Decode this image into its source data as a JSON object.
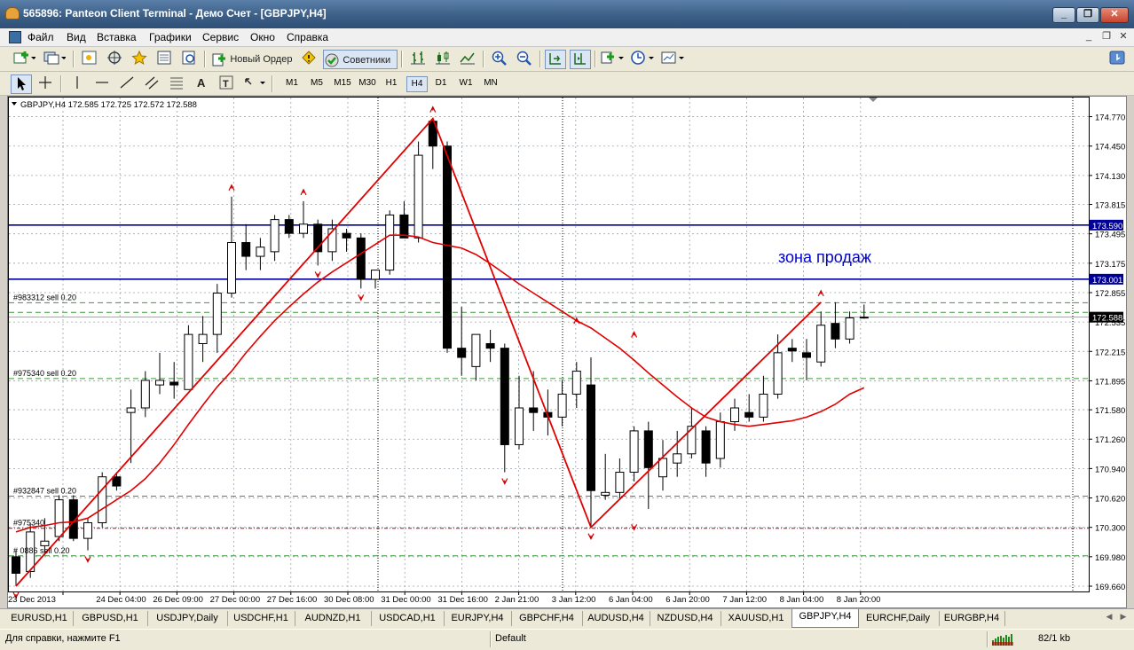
{
  "window": {
    "title": "565896: Panteon Client Terminal - Демо Счет - [GBPJPY,H4]",
    "minimize": "_",
    "restore": "❐",
    "close": "✕"
  },
  "menu": {
    "items": [
      "Файл",
      "Вид",
      "Вставка",
      "Графики",
      "Сервис",
      "Окно",
      "Справка"
    ],
    "child_min": "_",
    "child_restore": "❐",
    "child_close": "✕"
  },
  "toolbar1": {
    "new_order": "Новый Ордер",
    "advisors": "Советники"
  },
  "toolbar2": {
    "timeframes": [
      "M1",
      "M5",
      "M15",
      "M30",
      "H1",
      "H4",
      "D1",
      "W1",
      "MN"
    ],
    "active_timeframe": "H4"
  },
  "chart": {
    "header": "GBPJPY,H4  172.585 172.725 172.572 172.588",
    "annotation": "зона продаж",
    "annotation_color": "#0000cc",
    "bull_color": "#ffffff",
    "bear_color": "#000000",
    "ma_color": "#e00000",
    "level_color": "#000099",
    "price_labels": [
      "174.770",
      "174.450",
      "174.130",
      "173.815",
      "173.495",
      "173.175",
      "172.855",
      "172.535",
      "172.215",
      "171.895",
      "171.580",
      "171.260",
      "170.940",
      "170.620",
      "170.300",
      "169.980",
      "169.660"
    ],
    "highlighted_prices": [
      {
        "value": "173.590",
        "type": "level"
      },
      {
        "value": "173.001",
        "type": "level"
      },
      {
        "value": "172.588",
        "type": "bid"
      }
    ],
    "order_labels": [
      {
        "text": "#983312 sell 0.20",
        "price": 172.745
      },
      {
        "text": "#975340 sell 0.20",
        "price": 171.92
      },
      {
        "text": "#932847 sell 0.20",
        "price": 170.64
      },
      {
        "text": "#975340",
        "price": 170.29
      },
      {
        "text": "# 0886 sell 0.20",
        "price": 169.99
      }
    ],
    "time_labels": [
      "23 Dec 2013",
      "24 Dec 04:00",
      "26 Dec 09:00",
      "27 Dec 00:00",
      "27 Dec 16:00",
      "30 Dec 08:00",
      "31 Dec 00:00",
      "31 Dec 16:00",
      "2 Jan 21:00",
      "3 Jan 12:00",
      "6 Jan 04:00",
      "6 Jan 20:00",
      "7 Jan 12:00",
      "8 Jan 04:00",
      "8 Jan 20:00"
    ]
  },
  "chart_data": {
    "type": "candlestick",
    "symbol": "GBPJPY",
    "timeframe": "H4",
    "ylim": [
      169.66,
      174.93
    ],
    "levels": [
      173.59,
      173.001
    ],
    "bid": 172.588,
    "dashed_levels": [
      172.745,
      172.64,
      171.92,
      170.64,
      170.29,
      169.99
    ],
    "candles": [
      {
        "o": 169.98,
        "h": 170.05,
        "l": 169.66,
        "c": 169.8
      },
      {
        "o": 169.82,
        "h": 170.35,
        "l": 169.75,
        "c": 170.25
      },
      {
        "o": 170.1,
        "h": 170.4,
        "l": 170.0,
        "c": 170.15
      },
      {
        "o": 170.2,
        "h": 170.65,
        "l": 170.15,
        "c": 170.6
      },
      {
        "o": 170.6,
        "h": 170.65,
        "l": 170.15,
        "c": 170.18
      },
      {
        "o": 170.18,
        "h": 170.4,
        "l": 170.05,
        "c": 170.35
      },
      {
        "o": 170.35,
        "h": 170.9,
        "l": 170.3,
        "c": 170.85
      },
      {
        "o": 170.85,
        "h": 170.9,
        "l": 170.7,
        "c": 170.75
      },
      {
        "o": 171.55,
        "h": 171.8,
        "l": 171.0,
        "c": 171.6
      },
      {
        "o": 171.6,
        "h": 172.0,
        "l": 171.5,
        "c": 171.9
      },
      {
        "o": 171.85,
        "h": 172.2,
        "l": 171.75,
        "c": 171.9
      },
      {
        "o": 171.88,
        "h": 172.1,
        "l": 171.7,
        "c": 171.85
      },
      {
        "o": 171.8,
        "h": 172.5,
        "l": 171.8,
        "c": 172.4
      },
      {
        "o": 172.3,
        "h": 172.6,
        "l": 172.1,
        "c": 172.4
      },
      {
        "o": 172.4,
        "h": 172.95,
        "l": 172.2,
        "c": 172.85
      },
      {
        "o": 172.85,
        "h": 173.9,
        "l": 172.8,
        "c": 173.4
      },
      {
        "o": 173.4,
        "h": 173.6,
        "l": 173.1,
        "c": 173.25
      },
      {
        "o": 173.25,
        "h": 173.45,
        "l": 173.1,
        "c": 173.35
      },
      {
        "o": 173.3,
        "h": 173.7,
        "l": 173.2,
        "c": 173.65
      },
      {
        "o": 173.65,
        "h": 173.7,
        "l": 173.45,
        "c": 173.5
      },
      {
        "o": 173.5,
        "h": 173.85,
        "l": 173.45,
        "c": 173.6
      },
      {
        "o": 173.6,
        "h": 173.65,
        "l": 173.15,
        "c": 173.3
      },
      {
        "o": 173.3,
        "h": 173.65,
        "l": 173.2,
        "c": 173.55
      },
      {
        "o": 173.5,
        "h": 173.55,
        "l": 173.3,
        "c": 173.45
      },
      {
        "o": 173.45,
        "h": 173.5,
        "l": 172.9,
        "c": 173.0
      },
      {
        "o": 173.0,
        "h": 173.1,
        "l": 172.9,
        "c": 173.1
      },
      {
        "o": 173.1,
        "h": 173.75,
        "l": 173.05,
        "c": 173.7
      },
      {
        "o": 173.7,
        "h": 173.85,
        "l": 173.5,
        "c": 173.45
      },
      {
        "o": 173.45,
        "h": 174.5,
        "l": 173.4,
        "c": 174.35
      },
      {
        "o": 174.72,
        "h": 174.75,
        "l": 174.2,
        "c": 174.45
      },
      {
        "o": 174.45,
        "h": 174.5,
        "l": 172.2,
        "c": 172.25
      },
      {
        "o": 172.25,
        "h": 172.7,
        "l": 171.95,
        "c": 172.15
      },
      {
        "o": 172.05,
        "h": 172.4,
        "l": 171.9,
        "c": 172.4
      },
      {
        "o": 172.3,
        "h": 172.45,
        "l": 172.1,
        "c": 172.25
      },
      {
        "o": 172.25,
        "h": 172.3,
        "l": 170.9,
        "c": 171.2
      },
      {
        "o": 171.2,
        "h": 171.95,
        "l": 171.15,
        "c": 171.6
      },
      {
        "o": 171.6,
        "h": 172.0,
        "l": 171.35,
        "c": 171.55
      },
      {
        "o": 171.55,
        "h": 171.8,
        "l": 171.3,
        "c": 171.5
      },
      {
        "o": 171.5,
        "h": 171.9,
        "l": 171.4,
        "c": 171.75
      },
      {
        "o": 171.75,
        "h": 172.1,
        "l": 171.6,
        "c": 172.0
      },
      {
        "o": 171.85,
        "h": 172.15,
        "l": 170.3,
        "c": 170.7
      },
      {
        "o": 170.65,
        "h": 171.1,
        "l": 170.6,
        "c": 170.68
      },
      {
        "o": 170.68,
        "h": 171.05,
        "l": 170.6,
        "c": 170.9
      },
      {
        "o": 170.9,
        "h": 171.4,
        "l": 170.8,
        "c": 171.35
      },
      {
        "o": 171.35,
        "h": 171.45,
        "l": 170.5,
        "c": 170.95
      },
      {
        "o": 170.85,
        "h": 171.25,
        "l": 170.7,
        "c": 171.05
      },
      {
        "o": 171.0,
        "h": 171.35,
        "l": 170.85,
        "c": 171.1
      },
      {
        "o": 171.1,
        "h": 171.6,
        "l": 171.05,
        "c": 171.4
      },
      {
        "o": 171.35,
        "h": 171.4,
        "l": 170.85,
        "c": 171.0
      },
      {
        "o": 171.05,
        "h": 171.55,
        "l": 170.95,
        "c": 171.45
      },
      {
        "o": 171.45,
        "h": 171.7,
        "l": 171.35,
        "c": 171.6
      },
      {
        "o": 171.55,
        "h": 171.75,
        "l": 171.45,
        "c": 171.5
      },
      {
        "o": 171.5,
        "h": 171.95,
        "l": 171.45,
        "c": 171.75
      },
      {
        "o": 171.75,
        "h": 172.4,
        "l": 171.7,
        "c": 172.2
      },
      {
        "o": 172.25,
        "h": 172.35,
        "l": 172.1,
        "c": 172.22
      },
      {
        "o": 172.2,
        "h": 172.35,
        "l": 171.9,
        "c": 172.15
      },
      {
        "o": 172.1,
        "h": 172.65,
        "l": 172.05,
        "c": 172.5
      },
      {
        "o": 172.52,
        "h": 172.75,
        "l": 172.25,
        "c": 172.35
      },
      {
        "o": 172.35,
        "h": 172.65,
        "l": 172.3,
        "c": 172.58
      },
      {
        "o": 172.585,
        "h": 172.725,
        "l": 172.572,
        "c": 172.588
      }
    ],
    "ma_slow": [
      170.25,
      170.3,
      170.32,
      170.35,
      170.36,
      170.4,
      170.5,
      170.6,
      170.7,
      170.83,
      171.0,
      171.2,
      171.42,
      171.63,
      171.83,
      172.0,
      172.2,
      172.38,
      172.55,
      172.7,
      172.84,
      172.97,
      173.08,
      173.18,
      173.28,
      173.38,
      173.48,
      173.48,
      173.46,
      173.4,
      173.37,
      173.34,
      173.27,
      173.17,
      173.06,
      172.95,
      172.85,
      172.75,
      172.65,
      172.55,
      172.47,
      172.36,
      172.25,
      172.12,
      171.98,
      171.85,
      171.72,
      171.6,
      171.5,
      171.45,
      171.42,
      171.4,
      171.42,
      171.44,
      171.46,
      171.5,
      171.56,
      171.64,
      171.75,
      171.82
    ],
    "zigzag": [
      {
        "i": 0,
        "p": 169.66
      },
      {
        "i": 29,
        "p": 174.75
      },
      {
        "i": 40,
        "p": 170.3
      },
      {
        "i": 56,
        "p": 172.75
      }
    ],
    "fractals_up": [
      {
        "i": 15,
        "p": 173.9
      },
      {
        "i": 20,
        "p": 173.85
      },
      {
        "i": 29,
        "p": 174.75
      },
      {
        "i": 39,
        "p": 172.45
      },
      {
        "i": 43,
        "p": 172.3
      },
      {
        "i": 56,
        "p": 172.75
      }
    ],
    "fractals_down": [
      {
        "i": 0,
        "p": 169.66
      },
      {
        "i": 5,
        "p": 170.05
      },
      {
        "i": 21,
        "p": 173.15
      },
      {
        "i": 24,
        "p": 172.9
      },
      {
        "i": 34,
        "p": 170.9
      },
      {
        "i": 40,
        "p": 170.3
      },
      {
        "i": 43,
        "p": 170.4
      }
    ]
  },
  "tabs": {
    "items": [
      "EURUSD,H1",
      "GBPUSD,H1",
      "USDJPY,Daily",
      "USDCHF,H1",
      "AUDNZD,H1",
      "USDCAD,H1",
      "EURJPY,H4",
      "GBPCHF,H4",
      "AUDUSD,H4",
      "NZDUSD,H4",
      "XAUUSD,H1",
      "GBPJPY,H4",
      "EURCHF,Daily",
      "EURGBP,H4"
    ],
    "active": "GBPJPY,H4"
  },
  "status": {
    "help": "Для справки, нажмите F1",
    "profile": "Default",
    "traffic": "82/1 kb"
  }
}
